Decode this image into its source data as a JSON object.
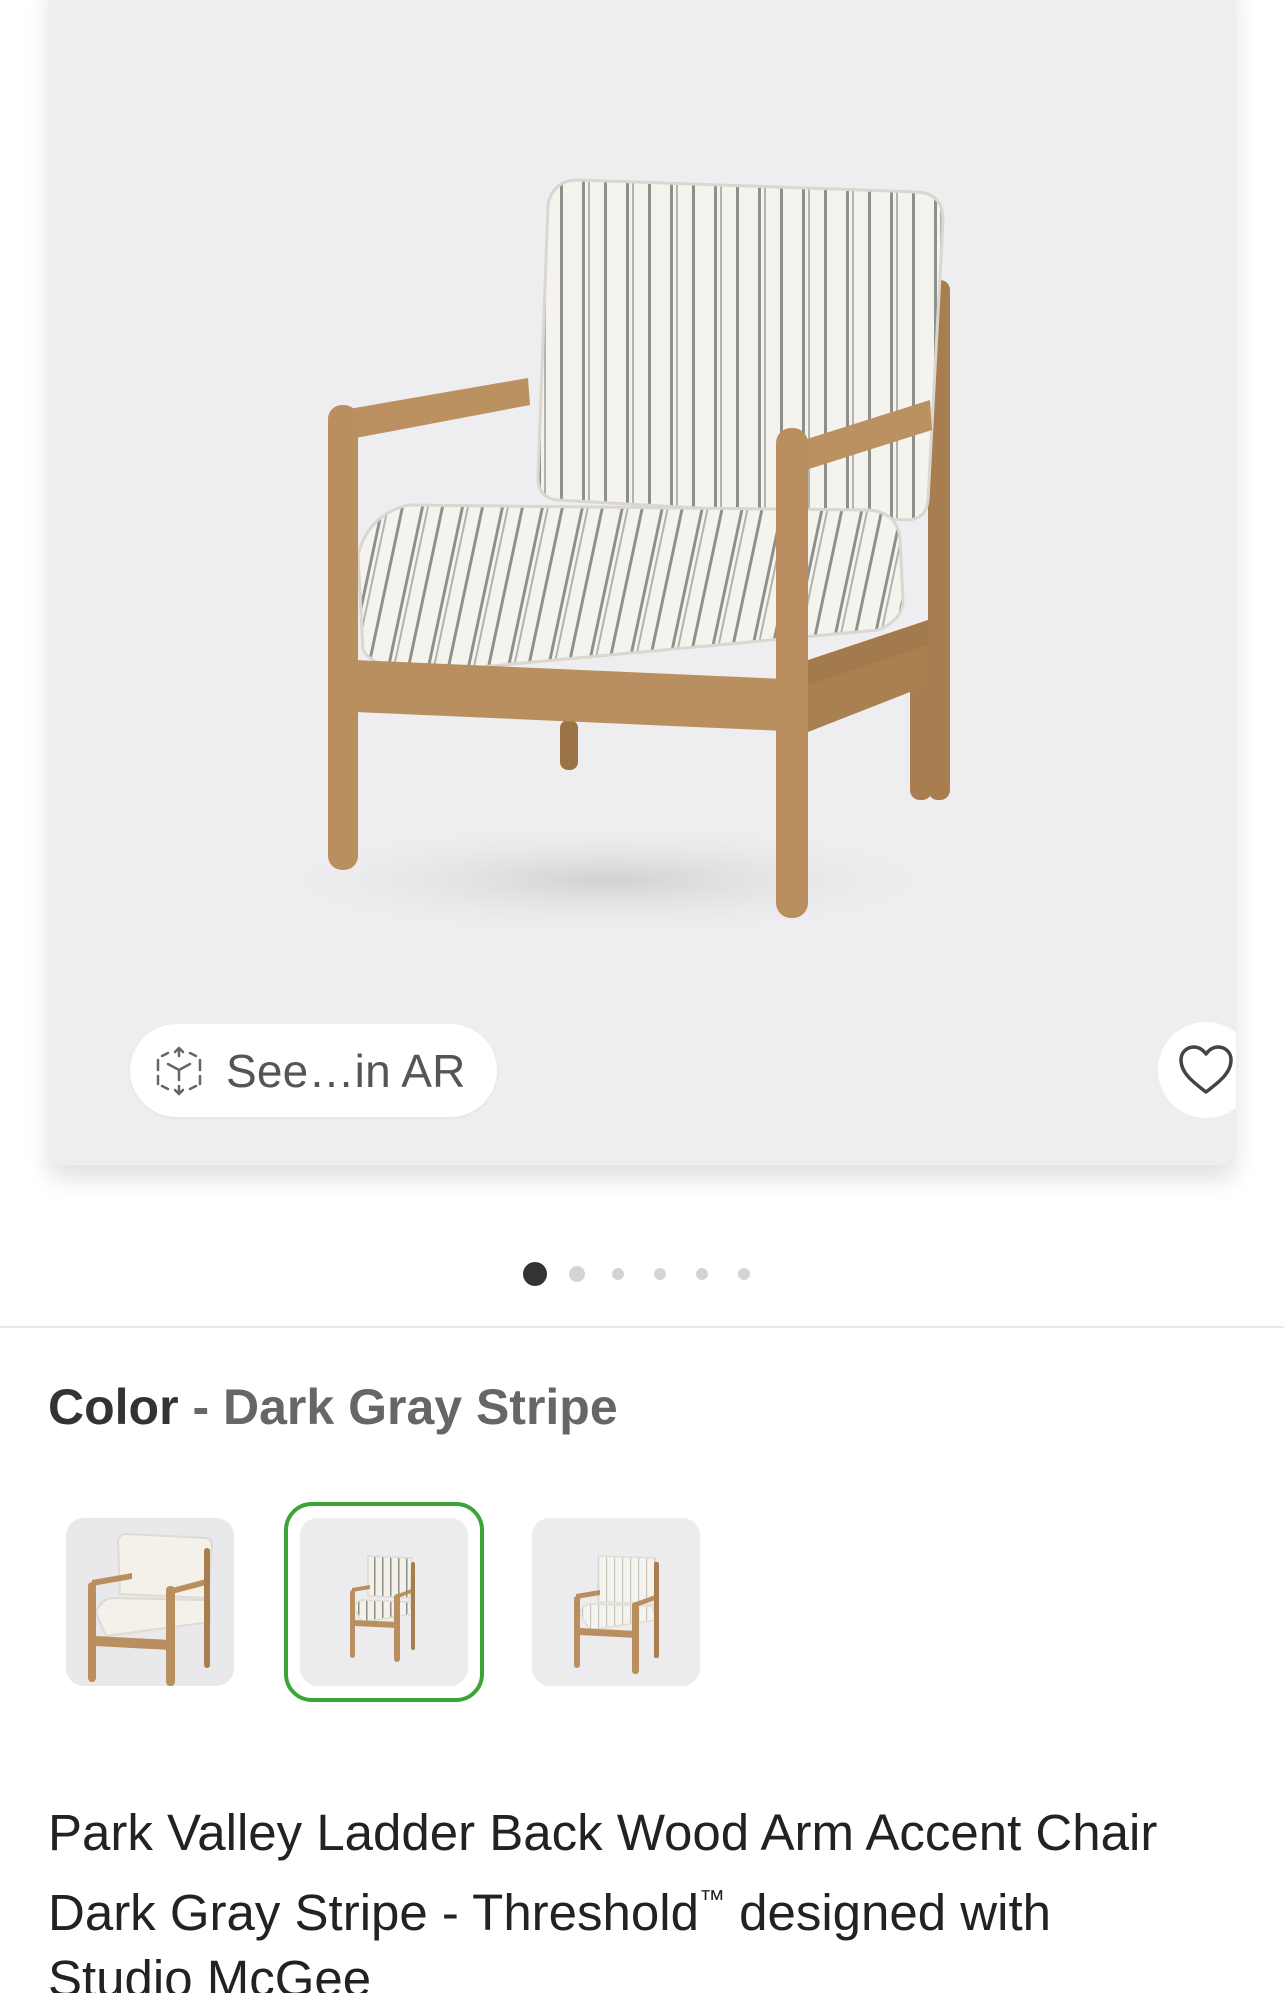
{
  "hero": {
    "ar_button_label": "See…in AR",
    "ar_icon": "ar-cube-icon",
    "favorite_icon": "heart-outline-icon"
  },
  "carousel": {
    "total_images": 6,
    "active_index": 0
  },
  "color_selector": {
    "label": "Color",
    "separator": "-",
    "selected_value": "Dark Gray Stripe",
    "swatches": [
      {
        "name": "Cream",
        "selected": false
      },
      {
        "name": "Dark Gray Stripe",
        "selected": true
      },
      {
        "name": "Light Stripe",
        "selected": false
      }
    ],
    "selected_ring_color": "#3aa536"
  },
  "product": {
    "title_line1": "Park Valley Ladder Back Wood Arm Accent Chair",
    "title_line2_a": "Dark Gray Stripe - Threshold",
    "title_tm": "™",
    "title_line2_b": " designed with",
    "title_line3": "Studio McGee"
  },
  "colors": {
    "wood": "#b98f5f",
    "fabric": "#f4f3ee",
    "stripe": "#8a8c88",
    "background": "#eeeef0"
  }
}
